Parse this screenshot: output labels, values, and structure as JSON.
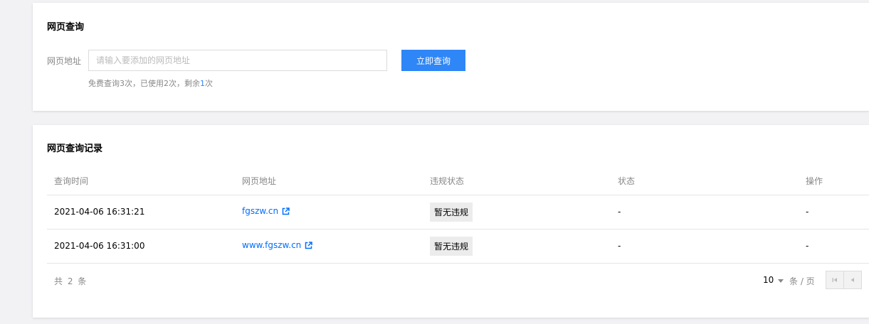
{
  "query_card": {
    "title": "网页查询",
    "address_label": "网页地址",
    "address_placeholder": "请输入要添加的网页地址",
    "address_value": "",
    "submit_label": "立即查询",
    "quota_text_before": "免费查询3次，已使用2次，剩余",
    "quota_remaining": "1",
    "quota_text_after": "次"
  },
  "records_card": {
    "title": "网页查询记录",
    "columns": [
      "查询时间",
      "网页地址",
      "违规状态",
      "状态",
      "操作"
    ],
    "rows": [
      {
        "time": "2021-04-06 16:31:21",
        "url": "fgszw.cn",
        "violation": "暂无违规",
        "status": "-",
        "action": "-"
      },
      {
        "time": "2021-04-06 16:31:00",
        "url": "www.fgszw.cn",
        "violation": "暂无违规",
        "status": "-",
        "action": "-"
      }
    ],
    "footer": {
      "total": "共 2 条",
      "page_size": "10",
      "per_page_label": "条 / 页"
    }
  },
  "colors": {
    "accent": "#2f86f6",
    "link": "#006eff",
    "page_bg": "#f2f2f5",
    "badge_bg": "#ececec"
  },
  "icons": {
    "external_link": "external-link-icon",
    "first_page": "first-page-icon",
    "prev_page": "prev-page-icon",
    "page_size_caret": "chevron-down-icon"
  }
}
